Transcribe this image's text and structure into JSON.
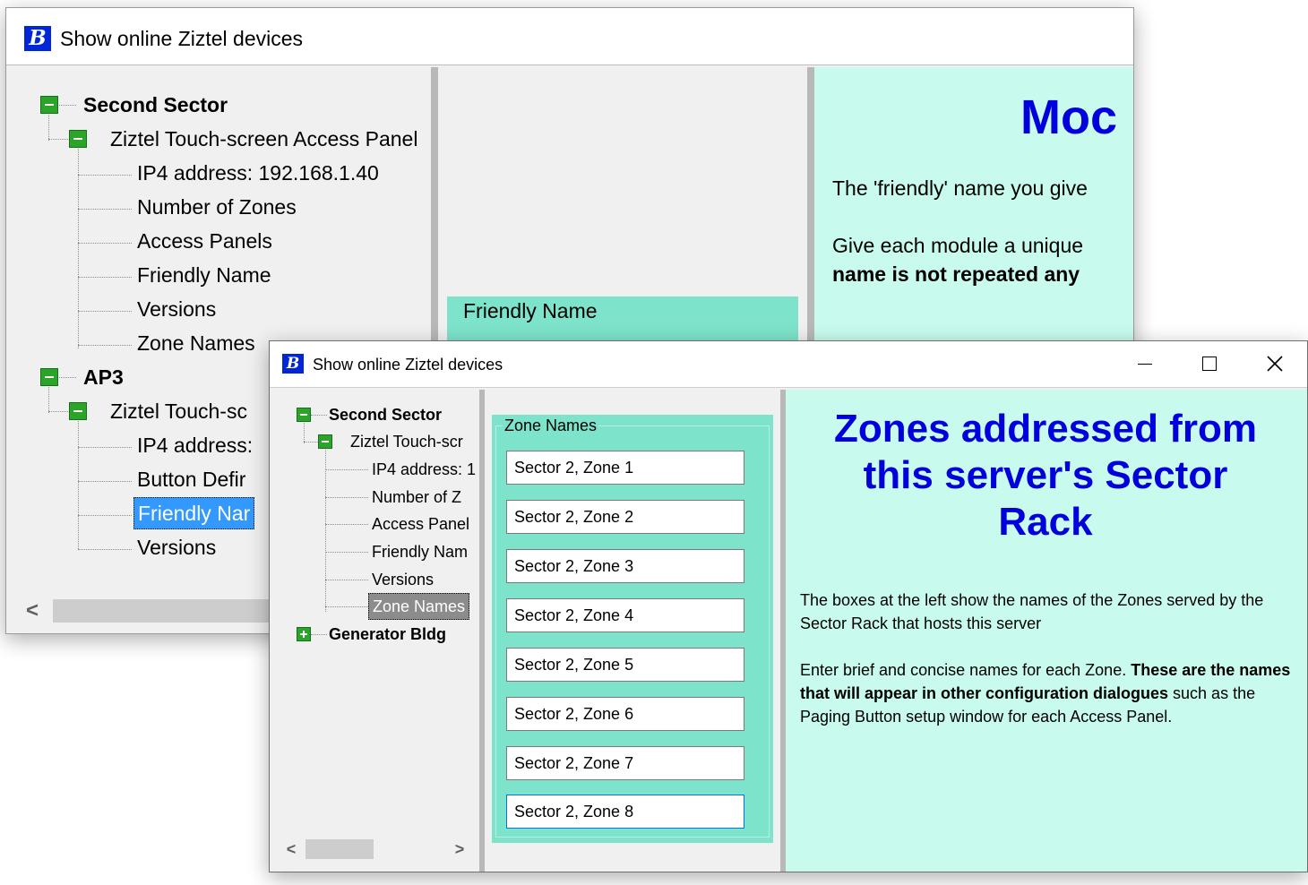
{
  "back_window": {
    "title": "Show online Ziztel devices",
    "icon_letter": "B",
    "tree": {
      "root1": "Second Sector",
      "root1_child": "Ziztel Touch-screen Access Panel",
      "root1_leaves": [
        "IP4 address: 192.168.1.40",
        "Number of Zones",
        "Access Panels",
        "Friendly Name",
        "Versions",
        "Zone Names"
      ],
      "root2": "AP3",
      "root2_child": "Ziztel Touch-sc",
      "root2_leaves": [
        "IP4 address:",
        "Button Defir",
        "Friendly Nar",
        "Versions"
      ]
    },
    "group_label": "Friendly Name",
    "info_heading": "Moc",
    "info_p1": "The 'friendly' name you give",
    "info_p2a": "Give each module a unique",
    "info_p2b": "name is not repeated any",
    "scroll_left": "<"
  },
  "front_window": {
    "title": "Show online Ziztel devices",
    "icon_letter": "B",
    "controls": {
      "minimize": "—",
      "maximize": "☐",
      "close": "✕"
    },
    "tree": {
      "root1": "Second Sector",
      "root1_child": "Ziztel Touch-scr",
      "root1_leaves": [
        "IP4 address: 1",
        "Number of Z",
        "Access Panel",
        "Friendly Nam",
        "Versions",
        "Zone Names"
      ],
      "root2": "Generator Bldg"
    },
    "scroll_left": "<",
    "scroll_right": ">",
    "zone_group_label": "Zone Names",
    "zones": [
      "Sector 2, Zone 1",
      "Sector 2, Zone 2",
      "Sector 2, Zone 3",
      "Sector 2, Zone 4",
      "Sector 2, Zone 5",
      "Sector 2, Zone 6",
      "Sector 2, Zone 7",
      "Sector 2, Zone 8"
    ],
    "info": {
      "heading": "Zones addressed from this server's Sector Rack",
      "p1": "The boxes at the left show the names of the Zones served by the Sector Rack that hosts this server",
      "p2_a": "Enter brief and concise names for each Zone. ",
      "p2_b": "These are the names that will appear in other configuration dialogues",
      "p2_c": " such as the Paging Button setup window for each Access Panel."
    }
  },
  "colors": {
    "info_bg": "#c8fbee",
    "zone_group_bg": "#7ee3cb",
    "heading_blue": "#0000dd",
    "selection_blue": "#3399ff",
    "tree_toggle_green": "#2aa52a"
  }
}
